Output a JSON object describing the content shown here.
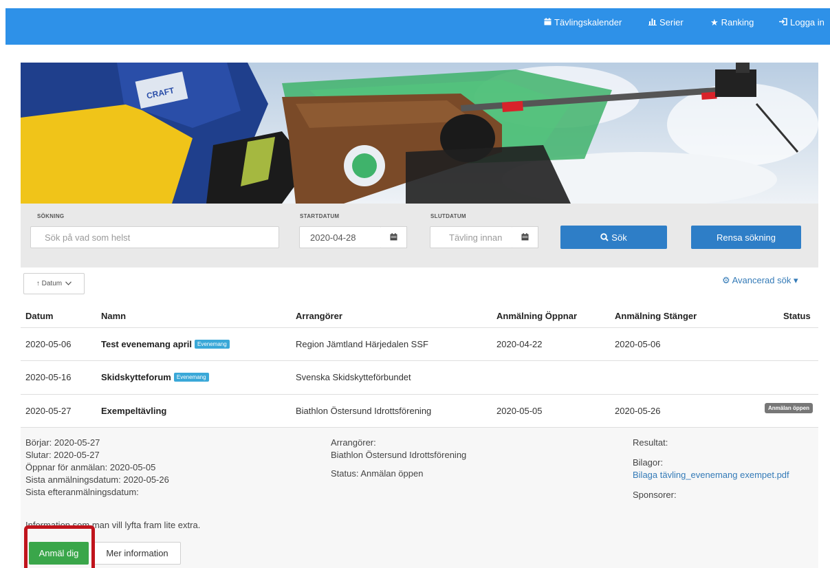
{
  "nav": {
    "calendar": "Tävlingskalender",
    "series": "Serier",
    "ranking": "Ranking",
    "login": "Logga in"
  },
  "search": {
    "label": "SÖKNING",
    "placeholder": "Sök på vad som helst",
    "start_label": "STARTDATUM",
    "start_value": "2020-04-28",
    "end_label": "SLUTDATUM",
    "end_placeholder": "Tävling innan",
    "search_button": "Sök",
    "clear_button": "Rensa sökning"
  },
  "sort": {
    "label": "↑ Datum"
  },
  "advanced": {
    "label": "Avancerad sök"
  },
  "table": {
    "headers": {
      "date": "Datum",
      "name": "Namn",
      "organizers": "Arrangörer",
      "opens": "Anmälning Öppnar",
      "closes": "Anmälning Stänger",
      "status": "Status"
    },
    "rows": [
      {
        "date": "2020-05-06",
        "name": "Test evenemang april",
        "tag": "Evenemang",
        "organizer": "Region Jämtland Härjedalen SSF",
        "opens": "2020-04-22",
        "closes": "2020-05-06",
        "status": ""
      },
      {
        "date": "2020-05-16",
        "name": "Skidskytteforum",
        "tag": "Evenemang",
        "organizer": "Svenska Skidskytteförbundet",
        "opens": "",
        "closes": "",
        "status": ""
      },
      {
        "date": "2020-05-27",
        "name": "Exempeltävling",
        "tag": "",
        "organizer": "Biathlon Östersund Idrottsförening",
        "opens": "2020-05-05",
        "closes": "2020-05-26",
        "status": "Anmälan öppen"
      }
    ]
  },
  "detail": {
    "starts": "Börjar: 2020-05-27",
    "ends": "Slutar: 2020-05-27",
    "opens": "Öppnar för anmälan: 2020-05-05",
    "last_date": "Sista anmälningsdatum: 2020-05-26",
    "late_date": "Sista efteranmälningsdatum:",
    "organizers_label": "Arrangörer:",
    "organizer": "Biathlon Östersund Idrottsförening",
    "status": "Status: Anmälan öppen",
    "results_label": "Resultat:",
    "attachments_label": "Bilagor:",
    "attachment_link": "Bilaga tävling_evenemang exempet.pdf",
    "sponsors_label": "Sponsorer:",
    "info": "Information som man vill lyfta fram lite extra.",
    "register_button": "Anmäl dig",
    "more_info_button": "Mer information"
  },
  "colors": {
    "navbar": "#2e91e8",
    "primary_button": "#2e7ec7",
    "register_button": "#3aa64a",
    "highlight": "#c0141c",
    "tag": "#3aa8d8",
    "status_badge": "#777777"
  },
  "icons": {
    "calendar": "calendar-icon",
    "series": "bar-chart-icon",
    "ranking": "star-icon",
    "login": "sign-in-icon",
    "search": "search-icon",
    "advanced": "gear-icon"
  }
}
